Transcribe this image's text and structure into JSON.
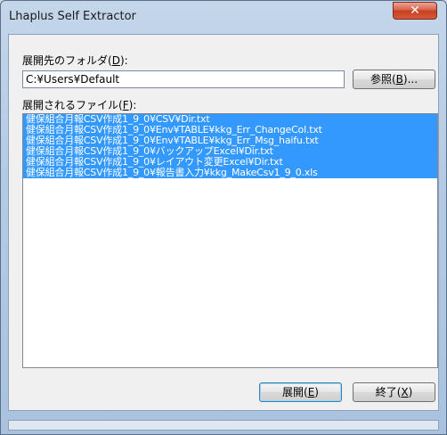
{
  "window": {
    "title": "Lhaplus Self Extractor",
    "close_glyph": "✕"
  },
  "dest": {
    "label_text": "展開先のフォルダ(",
    "label_key": "D",
    "label_suffix": "):",
    "value": "C:¥Users¥Default"
  },
  "browse_button": {
    "text": "参照(",
    "key": "B",
    "suffix": ")..."
  },
  "files": {
    "label_text": "展開されるファイル(",
    "label_key": "F",
    "label_suffix": "):",
    "items": [
      "健保組合月報CSV作成1_9_0¥CSV¥Dir.txt",
      "健保組合月報CSV作成1_9_0¥Env¥TABLE¥kkg_Err_ChangeCol.txt",
      "健保組合月報CSV作成1_9_0¥Env¥TABLE¥kkg_Err_Msg_haifu.txt",
      "健保組合月報CSV作成1_9_0¥バックアップExcel¥Dir.txt",
      "健保組合月報CSV作成1_9_0¥レイアウト変更Excel¥Dir.txt",
      "健保組合月報CSV作成1_9_0¥報告書入力¥kkg_MakeCsv1_9_0.xls"
    ]
  },
  "extract_button": {
    "text": "展開(",
    "key": "E",
    "suffix": ")"
  },
  "exit_button": {
    "text": "終了(",
    "key": "X",
    "suffix": ")"
  },
  "colors": {
    "selection": "#3399ff",
    "window_frame": "#b4cbe3",
    "close_red": "#c43e22"
  }
}
